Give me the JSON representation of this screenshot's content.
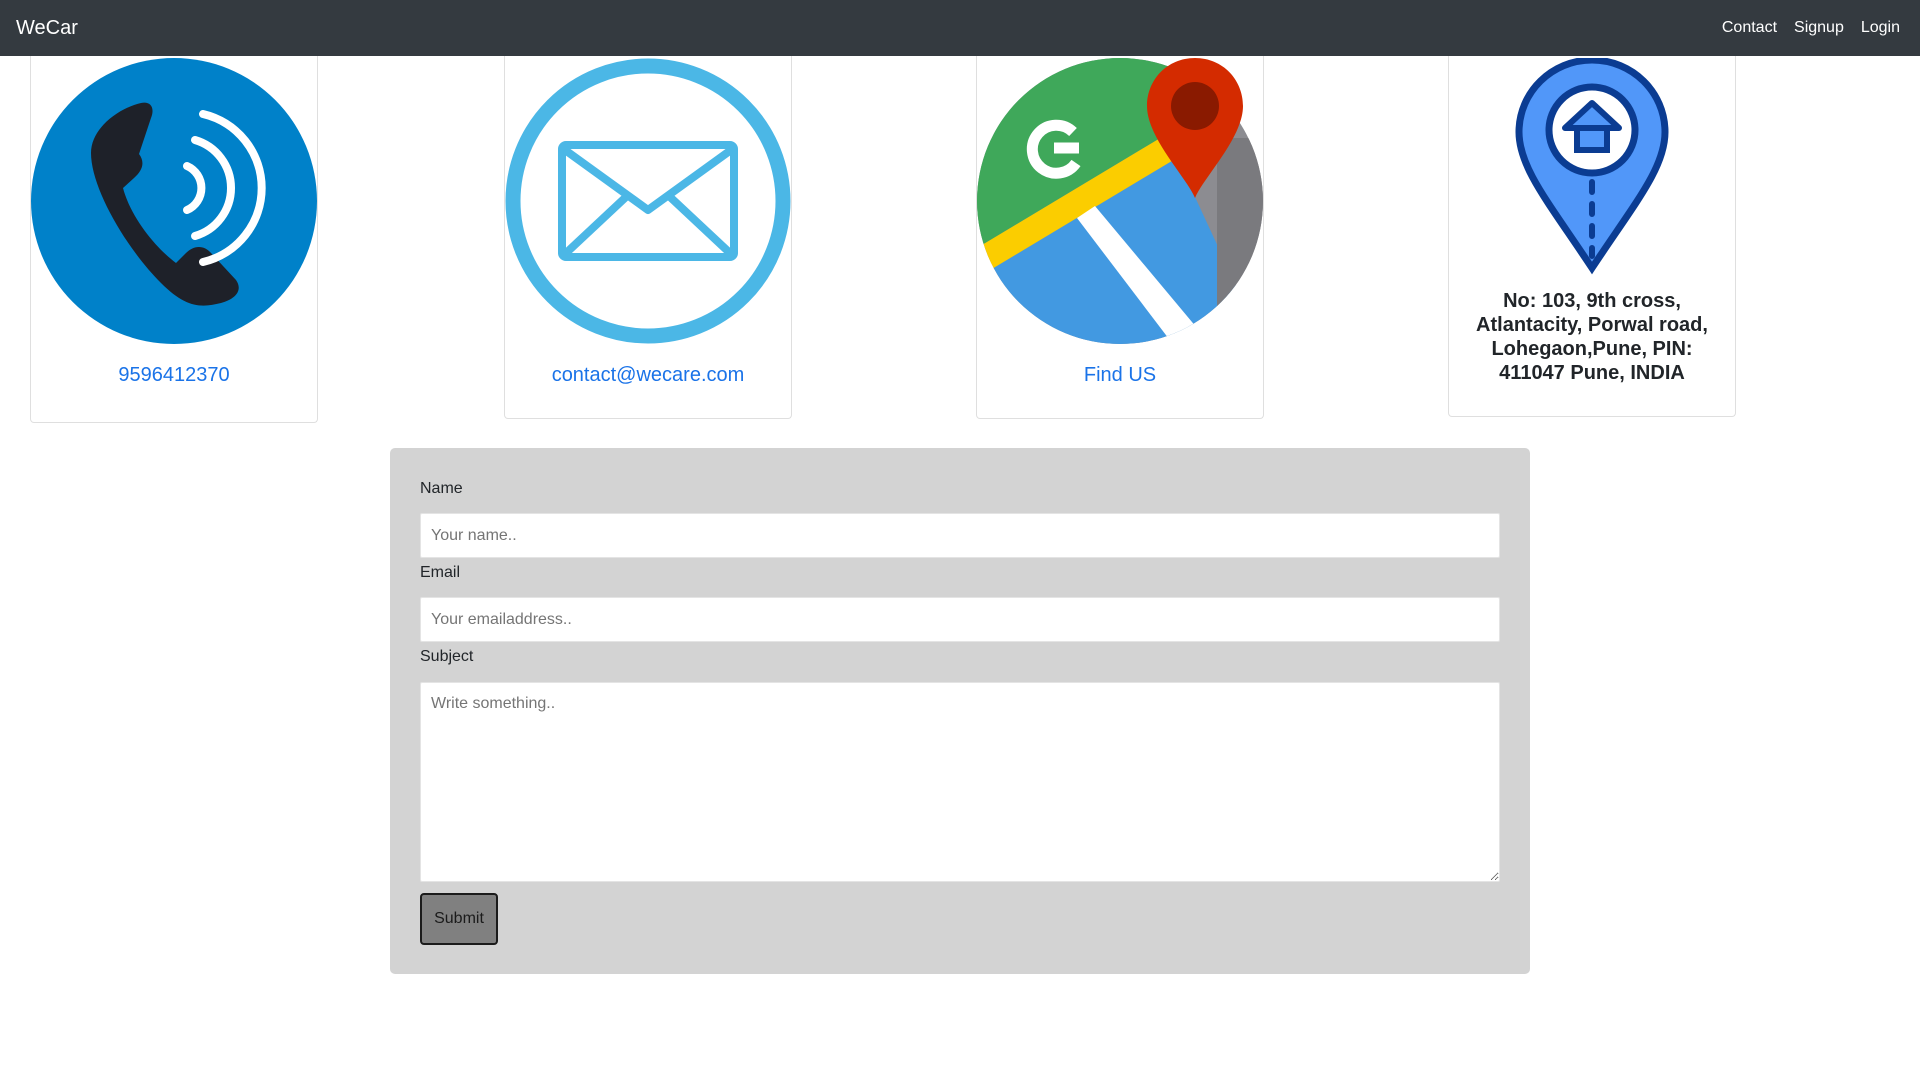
{
  "navbar": {
    "brand": "WeCar",
    "links": [
      {
        "label": "Contact"
      },
      {
        "label": "Signup"
      },
      {
        "label": "Login"
      }
    ]
  },
  "cards": {
    "phone": {
      "text": "9596412370",
      "icon": "phone-icon",
      "color": "#0081c9"
    },
    "email": {
      "text": "contact@wecare.com",
      "icon": "mail-icon",
      "color": "#4bb7e6"
    },
    "map": {
      "text": "Find US",
      "icon": "google-maps-icon"
    },
    "address": {
      "text": "No: 103, 9th cross, Atlantacity, Porwal road, Lohegaon,Pune, PIN: 411047 Pune, INDIA",
      "icon": "home-location-pin-icon",
      "color": "#5197f9"
    }
  },
  "form": {
    "name_label": "Name",
    "name_placeholder": "Your name..",
    "email_label": "Email",
    "email_placeholder": "Your emailaddress..",
    "subject_label": "Subject",
    "subject_placeholder": "Write something..",
    "submit_label": "Submit"
  },
  "colors": {
    "navbar_bg": "#343a40",
    "link_blue": "#1a73e8",
    "form_bg": "#d3d3d3",
    "submit_bg": "#808080"
  }
}
